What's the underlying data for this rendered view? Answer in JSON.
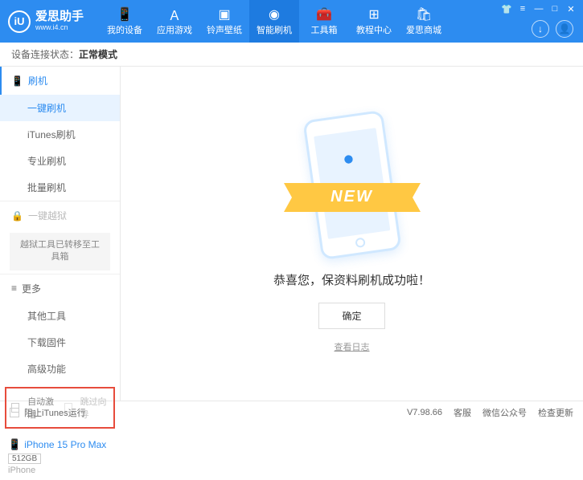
{
  "app": {
    "title": "爱思助手",
    "subtitle": "www.i4.cn"
  },
  "nav": {
    "items": [
      {
        "label": "我的设备"
      },
      {
        "label": "应用游戏"
      },
      {
        "label": "铃声壁纸"
      },
      {
        "label": "智能刷机"
      },
      {
        "label": "工具箱"
      },
      {
        "label": "教程中心"
      },
      {
        "label": "爱思商城"
      }
    ]
  },
  "status": {
    "label": "设备连接状态：",
    "value": "正常模式"
  },
  "sidebar": {
    "flash": {
      "title": "刷机",
      "items": [
        "一键刷机",
        "iTunes刷机",
        "专业刷机",
        "批量刷机"
      ]
    },
    "jailbreak": {
      "title": "一键越狱",
      "note": "越狱工具已转移至工具箱"
    },
    "more": {
      "title": "更多",
      "items": [
        "其他工具",
        "下载固件",
        "高级功能"
      ]
    },
    "checks": {
      "auto_activate": "自动激活",
      "skip_guide": "跳过向导"
    },
    "device": {
      "name": "iPhone 15 Pro Max",
      "storage": "512GB",
      "type": "iPhone"
    }
  },
  "main": {
    "badge": "NEW",
    "success": "恭喜您，保资料刷机成功啦！",
    "ok": "确定",
    "log": "查看日志"
  },
  "footer": {
    "block_itunes": "阻止iTunes运行",
    "version": "V7.98.66",
    "links": [
      "客服",
      "微信公众号",
      "检查更新"
    ]
  }
}
